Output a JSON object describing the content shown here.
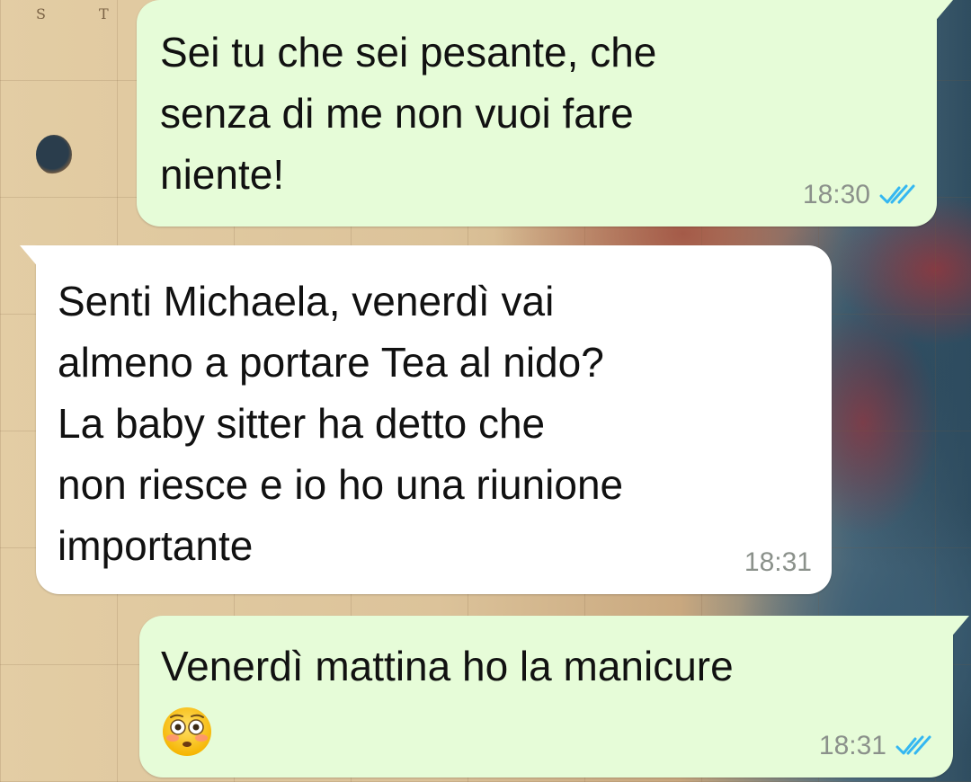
{
  "background": {
    "map_letters": [
      "S",
      "T"
    ]
  },
  "messages": [
    {
      "direction": "outgoing",
      "text": "Sei tu che sei pesante, che\nsenza di me non vuoi fare\nniente!",
      "time": "18:30",
      "status_icon": "double-check-read-icon",
      "status_color": "#34b7f1"
    },
    {
      "direction": "incoming",
      "text": "Senti Michaela, venerdì vai\nalmeno a portare Tea al nido?\nLa baby sitter ha detto che\nnon riesce e io ho una riunione\nimportante",
      "time": "18:31"
    },
    {
      "direction": "outgoing",
      "text": "Venerdì mattina ho la manicure",
      "emoji": "flushed-face-emoji",
      "time": "18:31",
      "status_icon": "double-check-read-icon",
      "status_color": "#34b7f1"
    }
  ],
  "colors": {
    "outgoing_bubble": "#e6fcd8",
    "incoming_bubble": "#ffffff",
    "timestamp": "#8b918b"
  }
}
